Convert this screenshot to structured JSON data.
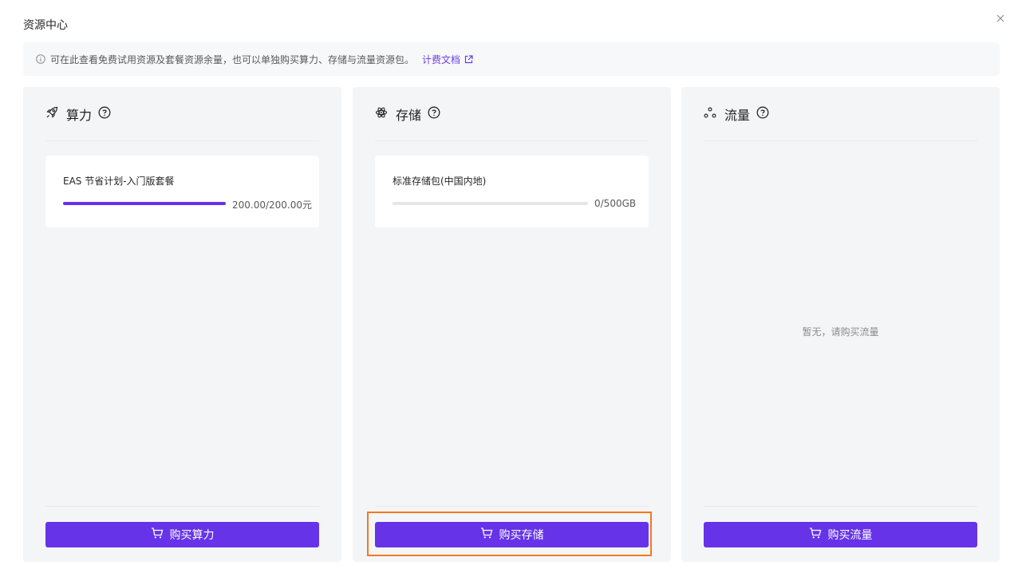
{
  "modal": {
    "title": "资源中心",
    "close_icon": "close-icon"
  },
  "info_bar": {
    "text": "可在此查看免费试用资源及套餐资源余量，也可以单独购买算力、存储与流量资源包。",
    "link_label": "计费文档",
    "icon": "info-icon",
    "link_icon": "external-link-icon"
  },
  "cards": [
    {
      "title": "算力",
      "icon": "rocket-icon",
      "resource": {
        "name": "EAS 节省计划-入门版套餐",
        "usage": "200.00/200.00元",
        "progress": 1.0
      },
      "buy_label": "购买算力"
    },
    {
      "title": "存储",
      "icon": "storage-icon",
      "resource": {
        "name": "标准存储包(中国内地)",
        "usage": "0/500GB",
        "progress": 0.0
      },
      "buy_label": "购买存储"
    },
    {
      "title": "流量",
      "icon": "traffic-icon",
      "empty_text": "暂无，请购买流量",
      "buy_label": "购买流量"
    }
  ],
  "colors": {
    "accent": "#6633e8",
    "highlight": "#f5781e",
    "card_bg": "#f4f5f7"
  }
}
